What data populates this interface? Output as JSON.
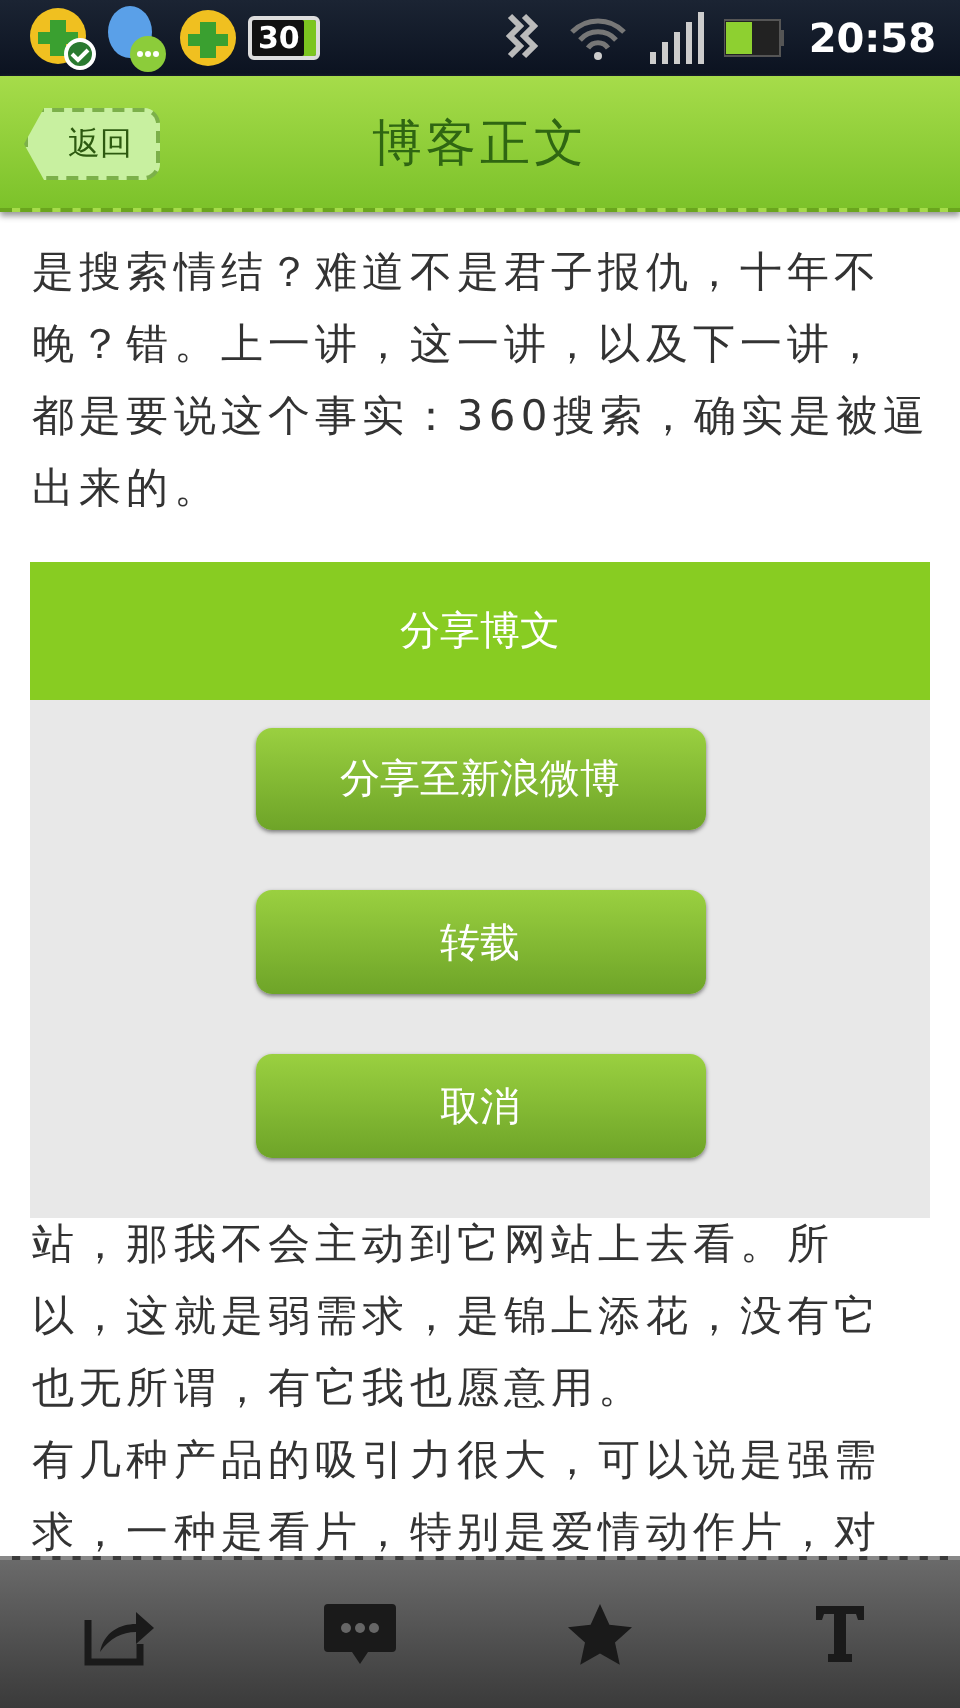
{
  "status_bar": {
    "badge": "30",
    "time": "20:58"
  },
  "header": {
    "back": "返回",
    "title": "博客正文"
  },
  "article": {
    "lines_above": [
      "是搜索情结？难道不是君子报仇，十年不",
      "晚？错。上一讲，这一讲，以及下一讲，",
      "都是要说这个事实：360搜索，确实是被逼",
      "出来的。"
    ],
    "lines_below": [
      "站，那我不会主动到它网站上去看。所",
      "以，这就是弱需求，是锦上添花，没有它",
      "也无所谓，有它我也愿意用。",
      "有几种产品的吸引力很大，可以说是强需",
      "求，一种是看片，特别是爱情动作片，对"
    ]
  },
  "dialog": {
    "title": "分享博文",
    "buttons": [
      "分享至新浪微博",
      "转载",
      "取消"
    ]
  }
}
